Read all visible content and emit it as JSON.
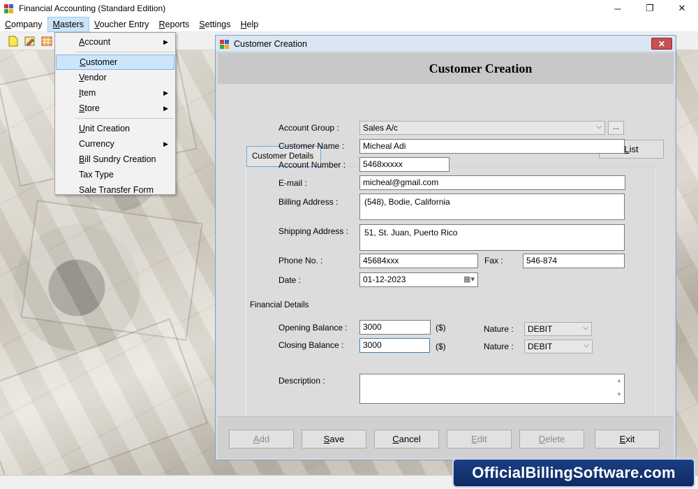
{
  "window": {
    "title": "Financial Accounting (Standard Edition)",
    "minimize": "─",
    "maximize": "❐",
    "close": "✕"
  },
  "menubar": [
    {
      "label": "Company",
      "accel": "C",
      "rest": "ompany"
    },
    {
      "label": "Masters",
      "accel": "M",
      "rest": "asters"
    },
    {
      "label": "Voucher Entry",
      "accel": "V",
      "rest": "oucher Entry"
    },
    {
      "label": "Reports",
      "accel": "R",
      "rest": "eports"
    },
    {
      "label": "Settings",
      "accel": "S",
      "rest": "ettings"
    },
    {
      "label": "Help",
      "accel": "H",
      "rest": "elp"
    }
  ],
  "masters_menu": {
    "account": {
      "a": "A",
      "b": "ccount"
    },
    "customer": {
      "a": "C",
      "b": "ustomer"
    },
    "vendor": {
      "a": "V",
      "b": "endor"
    },
    "item": {
      "a": "I",
      "b": "tem"
    },
    "store": {
      "a": "S",
      "b": "tore"
    },
    "unit_creation": {
      "a": "U",
      "b": "nit Creation"
    },
    "currency": "Currency",
    "bill_sundry": {
      "a": "B",
      "b": "ill Sundry Creation"
    },
    "tax_type": "Tax Type",
    "sale_transfer": "Sale Transfer Form",
    "submenu_arrow": "▶"
  },
  "dialog": {
    "title": "Customer Creation",
    "heading": "Customer Creation",
    "close": "✕",
    "list_button": {
      "a": "L",
      "b": "ist"
    },
    "tab_customer_details": "Customer Details",
    "labels": {
      "account_group": "Account Group :",
      "customer_name": "Customer Name :",
      "account_number": "Account Number :",
      "email": "E-mail :",
      "billing_address": "Billing Address :",
      "shipping_address": "Shipping Address :",
      "phone": "Phone No. :",
      "fax": "Fax :",
      "date": "Date :",
      "financial_details": "Financial Details",
      "opening_balance": "Opening Balance :",
      "closing_balance": "Closing Balance :",
      "nature1": "Nature :",
      "nature2": "Nature :",
      "currency1": "($)",
      "currency2": "($)",
      "description": "Description :"
    },
    "values": {
      "account_group": "Sales A/c",
      "dots": "...",
      "customer_name": "Micheal Adi",
      "account_number": "5468xxxxx",
      "email": "micheal@gmail.com",
      "billing_address": "(548), Bodie, California",
      "shipping_address": "51, St. Juan, Puerto Rico",
      "phone": "45684xxx",
      "fax": "546-874",
      "date": "01-12-2023",
      "opening_balance": "3000",
      "closing_balance": "3000",
      "nature1": "DEBIT",
      "nature2": "DEBIT",
      "description": ""
    },
    "buttons": {
      "add": {
        "a": "A",
        "b": "dd"
      },
      "save": {
        "a": "S",
        "b": "ave"
      },
      "cancel": {
        "a": "C",
        "b": "ancel"
      },
      "edit": {
        "a": "E",
        "b": "dit"
      },
      "delete": {
        "a": "D",
        "b": "elete"
      },
      "exit": {
        "a": "E",
        "b": "xit"
      }
    }
  },
  "watermark": "OfficialBillingSoftware.com",
  "icons": {
    "chevron": "⌵",
    "scroll_up": "▲",
    "scroll_down": "▼",
    "calendar": "▦▾"
  },
  "colors": {
    "dialog_border": "#7a9fcf",
    "menu_highlight": "#cde5f8",
    "watermark_bg": "#1b3f83",
    "close_red": "#c75050"
  }
}
